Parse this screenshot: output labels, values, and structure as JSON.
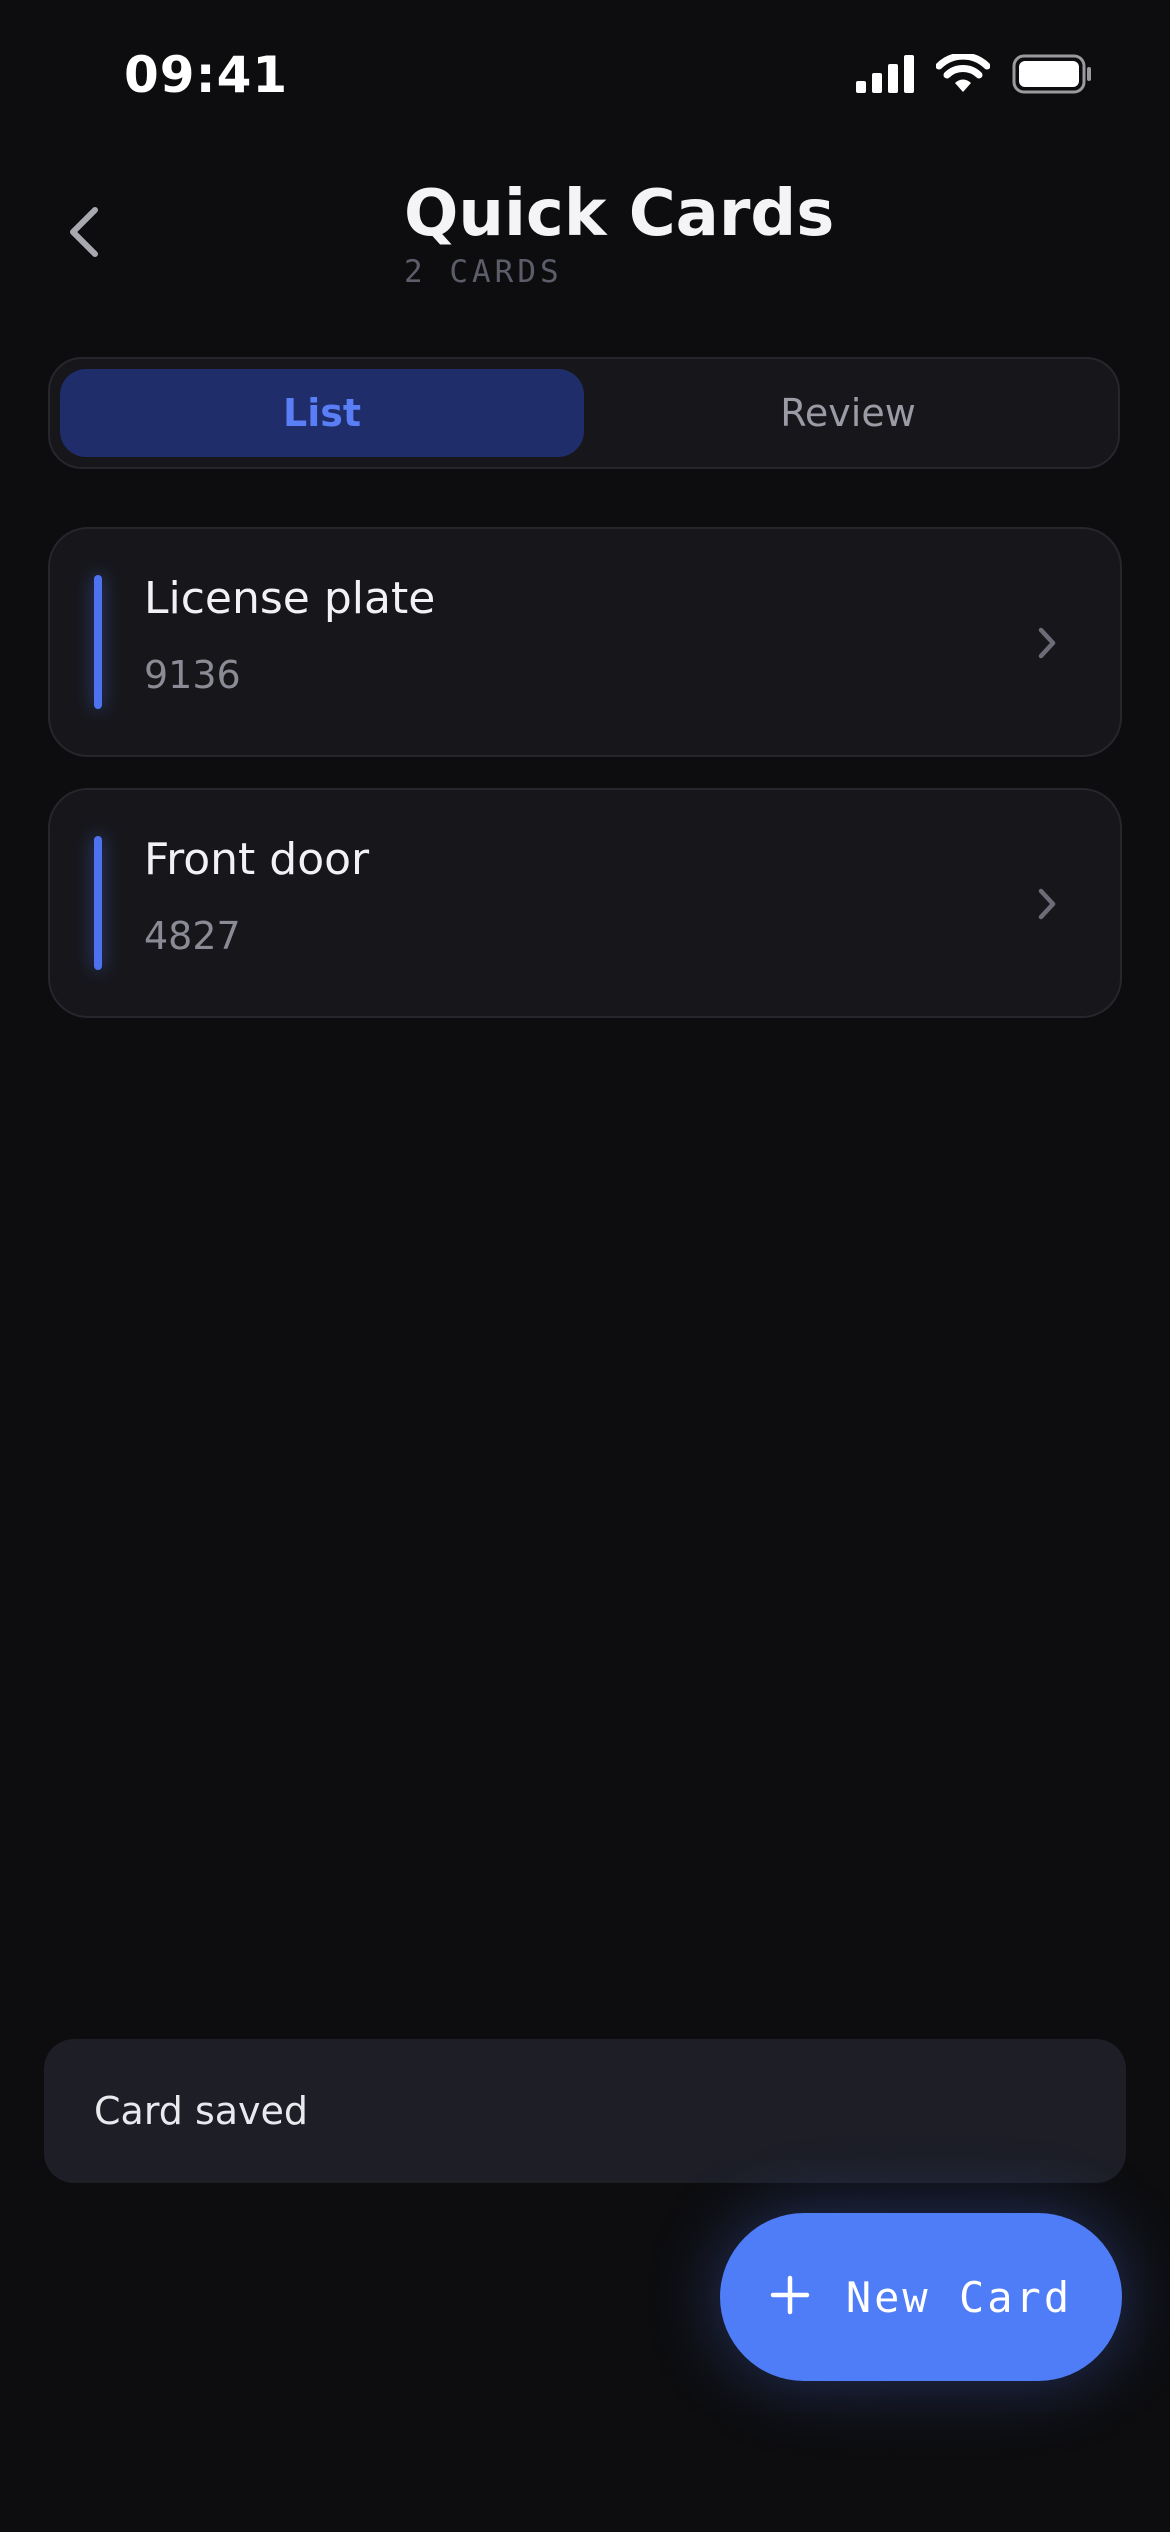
{
  "status_bar": {
    "time": "09:41",
    "icons": [
      "signal-icon",
      "wifi-icon",
      "battery-icon"
    ]
  },
  "header": {
    "back_icon": "chevron-left-icon",
    "title": "Quick Cards",
    "subtitle": "2 CARDS"
  },
  "tabs": [
    {
      "label": "List",
      "active": true
    },
    {
      "label": "Review",
      "active": false
    }
  ],
  "cards": [
    {
      "title": "License plate",
      "value": "9136"
    },
    {
      "title": "Front door",
      "value": "4827"
    }
  ],
  "toast": {
    "text": "Card saved"
  },
  "fab": {
    "icon": "plus-icon",
    "label": "New Card"
  },
  "colors": {
    "background": "#0d0d0f",
    "accent": "#4f7cf7",
    "active_tab_bg": "#1f2d6b",
    "card_bg": "#17171b"
  }
}
